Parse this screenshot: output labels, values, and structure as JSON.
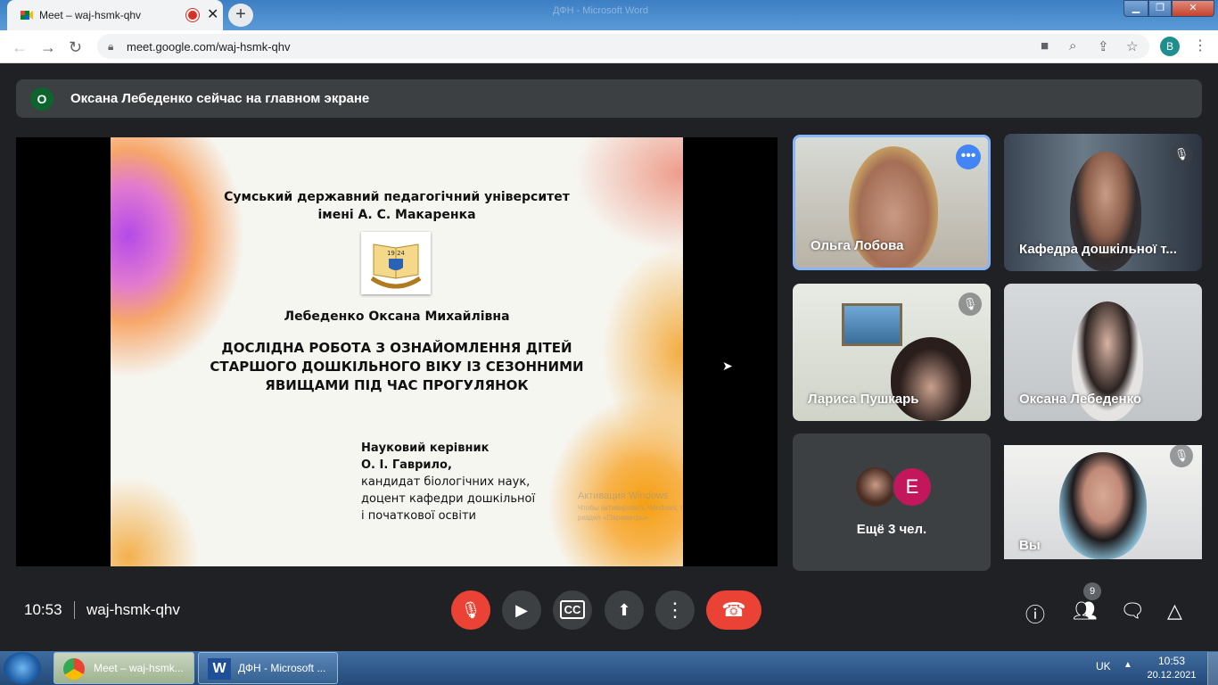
{
  "browser": {
    "tab_title": "Meet – waj-hsmk-qhv",
    "new_tab": "+",
    "url": "meet.google.com/waj-hsmk-qhv",
    "profile_initial": "B",
    "window_buttons": [
      "▁",
      "❐",
      "✕"
    ],
    "window_caption": "ДФН - Microsoft Word"
  },
  "banner": {
    "avatar": "О",
    "text": "Оксана Лебеденко сейчас на главном экране"
  },
  "slide": {
    "line1": "Сумський державний педагогічний університет",
    "line2": "імені А. С. Макаренка",
    "emblem_year": "19 24",
    "author": "Лебеденко Оксана Михайлівна",
    "title1": "ДОСЛІДНА РОБОТА З ОЗНАЙОМЛЕННЯ ДІТЕЙ",
    "title2": "СТАРШОГО ДОШКІЛЬНОГО ВІКУ ІЗ СЕЗОННИМИ",
    "title3": "ЯВИЩАМИ ПІД ЧАС ПРОГУЛЯНОК",
    "sup_label": "Науковий керівник",
    "sup_name": "О. І. Гаврило,",
    "sup_3": "кандидат біологічних наук,",
    "sup_4": "доцент  кафедри  дошкільної",
    "sup_5": "і початкової освіти",
    "watermark1": "Активация Windows",
    "watermark2": "Чтобы активировать Windows, перейдите в",
    "watermark3": "раздел «Параметры»."
  },
  "participants": [
    {
      "name": "Ольга Лобова"
    },
    {
      "name": "Кафедра дошкільної т..."
    },
    {
      "name": "Лариса Пушкарь"
    },
    {
      "name": "Оксана Лебеденко"
    },
    {
      "name": "Ещё 3 чел.",
      "avatar2": "E"
    },
    {
      "name": "Вы"
    }
  ],
  "meeting": {
    "time": "10:53",
    "code": "waj-hsmk-qhv",
    "participant_count": "9"
  },
  "taskbar": {
    "chrome_task": "Meet – waj-hsmk...",
    "word_task": "ДФН - Microsoft ...",
    "lang": "UK",
    "clock_time": "10:53",
    "clock_date": "20.12.2021"
  },
  "colors": {
    "meet_bg": "#202124",
    "end_call": "#ea4335",
    "active_speaker_border": "#8ab4f8"
  }
}
